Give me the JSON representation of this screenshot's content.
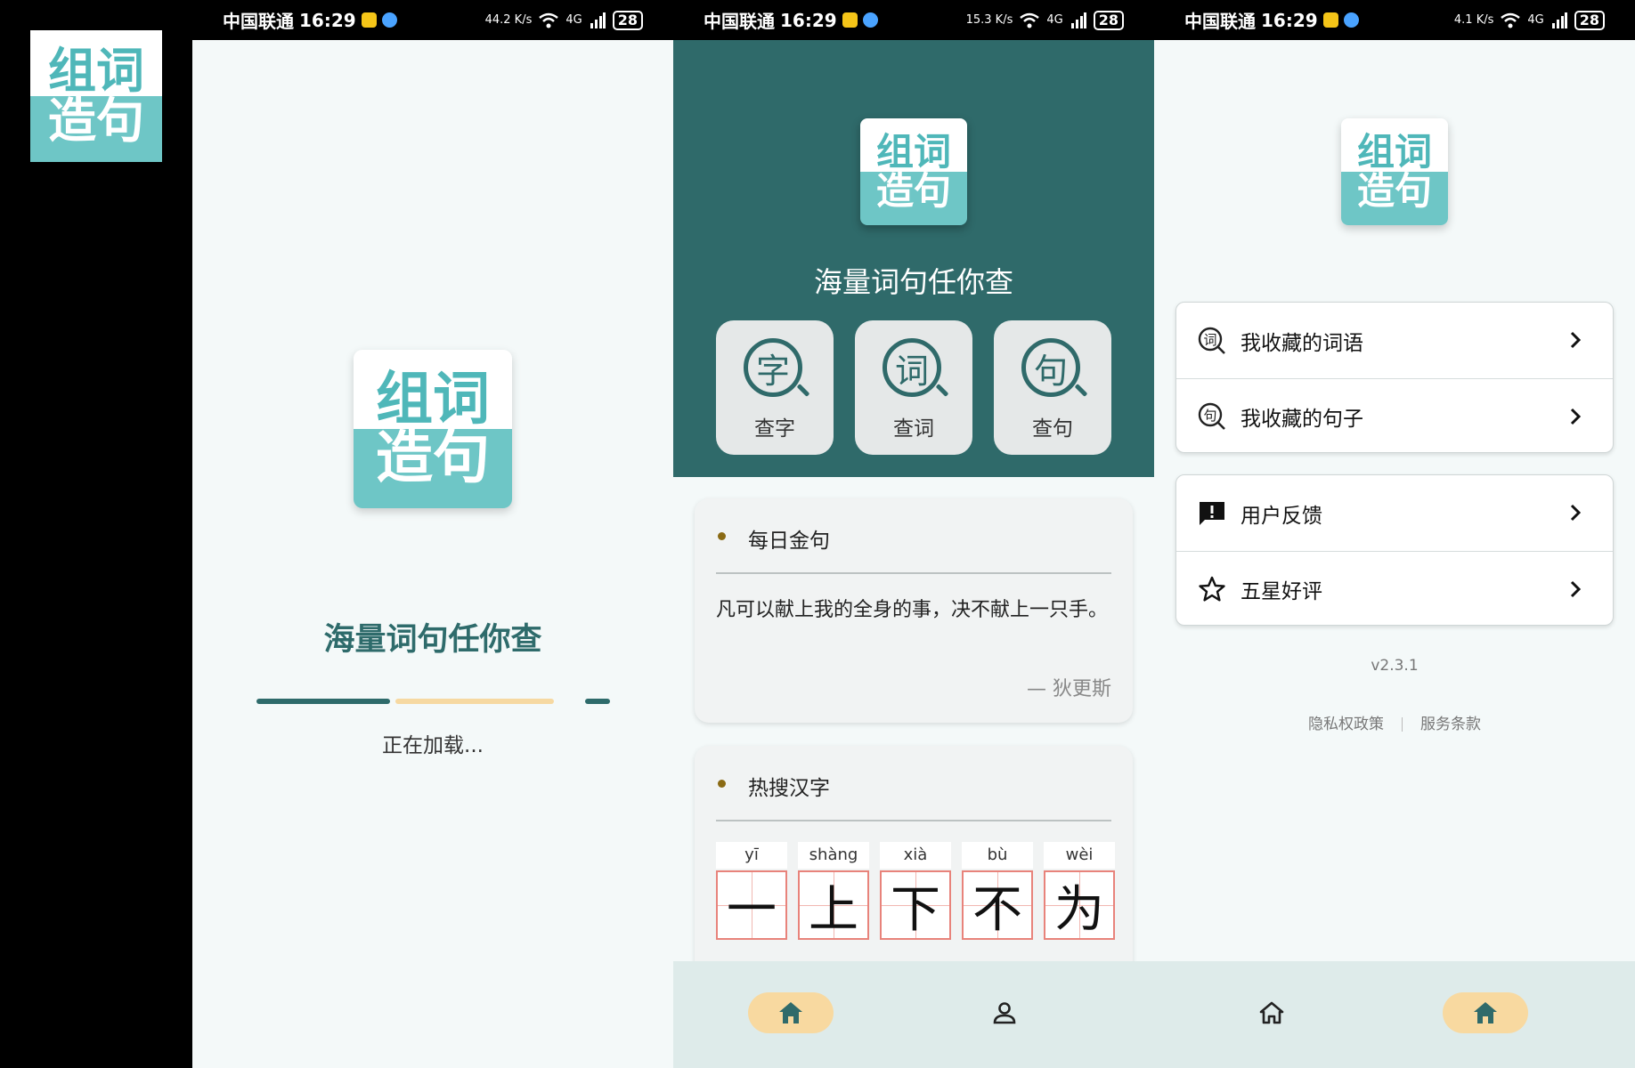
{
  "app": {
    "logo_top": "组词",
    "logo_bottom": "造句",
    "slogan": "海量词句任你查"
  },
  "colors": {
    "primary": "#2f6a6a",
    "accent": "#f8d9a0",
    "logo_teal": "#6ec6c6",
    "grid_red": "#e8837b"
  },
  "status_bars": [
    {
      "carrier": "中国联通",
      "time": "16:29",
      "net_speed": "44.2 K/s",
      "signal": "4G",
      "battery": "28"
    },
    {
      "carrier": "中国联通",
      "time": "16:29",
      "net_speed": "15.3 K/s",
      "signal": "4G",
      "battery": "28"
    },
    {
      "carrier": "中国联通",
      "time": "16:29",
      "net_speed": "4.1 K/s",
      "signal": "4G",
      "battery": "28"
    }
  ],
  "splash": {
    "loading_text": "正在加载...",
    "progress": 0.64
  },
  "home": {
    "quick_actions": [
      {
        "glyph": "字",
        "label": "查字",
        "icon": "search-char-icon"
      },
      {
        "glyph": "词",
        "label": "查词",
        "icon": "search-word-icon"
      },
      {
        "glyph": "句",
        "label": "查句",
        "icon": "search-sentence-icon"
      }
    ],
    "daily_quote": {
      "title": "每日金句",
      "text": "凡可以献上我的全身的事，决不献上一只手。",
      "author": "— 狄更斯"
    },
    "hot_chars": {
      "title": "热搜汉字",
      "items": [
        {
          "pinyin": "yī",
          "char": "一"
        },
        {
          "pinyin": "shàng",
          "char": "上"
        },
        {
          "pinyin": "xià",
          "char": "下"
        },
        {
          "pinyin": "bù",
          "char": "不"
        },
        {
          "pinyin": "wèi",
          "char": "为"
        }
      ]
    }
  },
  "profile": {
    "menu_group1": [
      {
        "label": "我收藏的词语",
        "icon": "word-search-icon",
        "glyph": "词"
      },
      {
        "label": "我收藏的句子",
        "icon": "sentence-search-icon",
        "glyph": "句"
      }
    ],
    "menu_group2": [
      {
        "label": "用户反馈",
        "icon": "feedback-icon"
      },
      {
        "label": "五星好评",
        "icon": "star-icon"
      }
    ],
    "version": "v2.3.1",
    "privacy": "隐私权政策",
    "terms": "服务条款"
  },
  "tabbar": {
    "home_icon": "home-icon",
    "profile_icon": "person-icon"
  }
}
